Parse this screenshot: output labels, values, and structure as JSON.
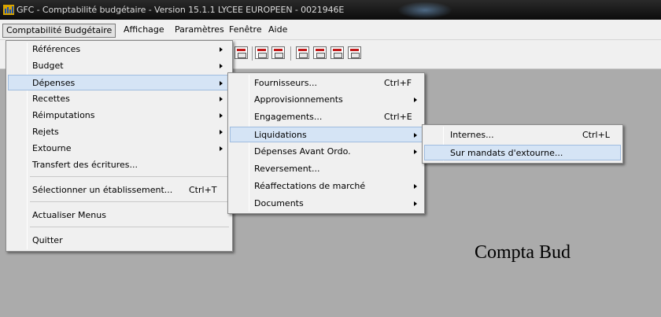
{
  "window": {
    "title": "GFC - Comptabilité budgétaire - Version 15.1.1   LYCEE EUROPEEN - 0021946E",
    "icon": "app-icon"
  },
  "menubar": {
    "items": [
      "Comptabilité Budgétaire",
      "Affichage",
      "Paramètres",
      "Fenêtre",
      "Aide"
    ]
  },
  "menu_main": {
    "items": [
      {
        "label": "Références",
        "submenu": true
      },
      {
        "label": "Budget",
        "submenu": true
      },
      {
        "label": "Dépenses",
        "submenu": true,
        "highlighted": true
      },
      {
        "label": "Recettes",
        "submenu": true
      },
      {
        "label": "Réimputations",
        "submenu": true
      },
      {
        "label": "Rejets",
        "submenu": true
      },
      {
        "label": "Extourne",
        "submenu": true
      },
      {
        "label": "Transfert des écritures..."
      },
      {
        "label": "Sélectionner un établissement...",
        "shortcut": "Ctrl+T"
      },
      {
        "label": "Actualiser Menus"
      },
      {
        "label": "Quitter"
      }
    ]
  },
  "menu_depenses": {
    "items": [
      {
        "label": "Fournisseurs...",
        "shortcut": "Ctrl+F"
      },
      {
        "label": "Approvisionnements",
        "submenu": true
      },
      {
        "label": "Engagements...",
        "shortcut": "Ctrl+E"
      },
      {
        "label": "Liquidations",
        "submenu": true,
        "highlighted": true
      },
      {
        "label": "Dépenses Avant Ordo.",
        "submenu": true
      },
      {
        "label": "Reversement..."
      },
      {
        "label": "Réaffectations de marché",
        "submenu": true
      },
      {
        "label": "Documents",
        "submenu": true
      }
    ]
  },
  "menu_liquidations": {
    "items": [
      {
        "label": "Internes...",
        "shortcut": "Ctrl+L"
      },
      {
        "label": "Sur mandats d'extourne...",
        "highlighted": true
      }
    ]
  },
  "background_text": "Compta Bud",
  "colors": {
    "workspace": "#ababab",
    "menu_bg": "#f0f0f0",
    "highlight": "#d5e4f5",
    "titlebar": "#111111"
  }
}
